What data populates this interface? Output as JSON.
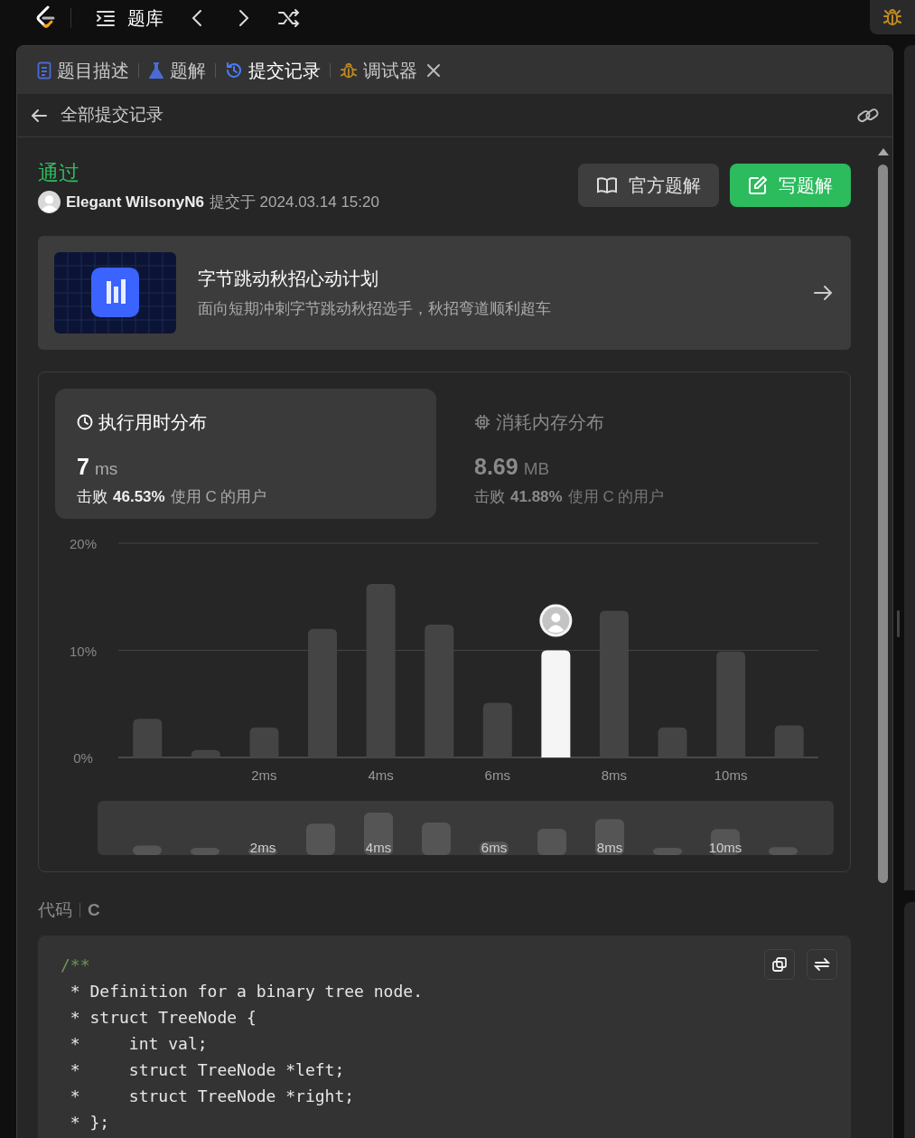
{
  "top_bar": {
    "nav_label": "题库"
  },
  "tabs": [
    {
      "label": "题目描述",
      "kind": "description",
      "selected": false,
      "closable": false
    },
    {
      "label": "题解",
      "kind": "solutions",
      "selected": false,
      "closable": false
    },
    {
      "label": "提交记录",
      "kind": "submissions",
      "selected": true,
      "closable": false
    },
    {
      "label": "调试器",
      "kind": "debugger",
      "selected": false,
      "closable": true
    }
  ],
  "subheader": {
    "title": "全部提交记录"
  },
  "submission": {
    "status": "通过",
    "user": "Elegant WilsonyN6",
    "submitted_at": "提交于 2024.03.14 15:20"
  },
  "buttons": [
    {
      "label": "官方题解",
      "kind": "secondary"
    },
    {
      "label": "写题解",
      "kind": "primary"
    }
  ],
  "banner": {
    "title": "字节跳动秋招心动计划",
    "subtitle": "面向短期冲刺字节跳动秋招选手，秋招弯道顺利超车"
  },
  "stats": [
    {
      "kind": "time",
      "title": "执行用时分布",
      "value": "7",
      "unit": "ms",
      "beat_label": "击败",
      "beat": "46.53%",
      "suffix": "使用 C 的用户",
      "selected": true
    },
    {
      "kind": "memory",
      "title": "消耗内存分布",
      "value": "8.69",
      "unit": "MB",
      "beat_label": "击败",
      "beat": "41.88%",
      "suffix": "使用 C 的用户",
      "selected": false
    }
  ],
  "chart": {
    "chart_data": {
      "type": "bar",
      "x": [
        0,
        1,
        2,
        3,
        4,
        5,
        6,
        7,
        8,
        9,
        10,
        11
      ],
      "series": [
        {
          "color": "#444444",
          "values": [
            3.6,
            0.7,
            2.8,
            12.0,
            16.2,
            12.4,
            5.1,
            null,
            13.7,
            2.8,
            9.9,
            3.0
          ]
        },
        {
          "color": "#f5f5f5",
          "values": [
            null,
            null,
            null,
            null,
            null,
            null,
            null,
            10.0,
            null,
            null,
            null,
            null
          ]
        }
      ],
      "xlim": [
        -0.5,
        11.5
      ],
      "ylim": [
        0,
        20
      ],
      "yticks": [
        {
          "value": 0,
          "label": "0%"
        },
        {
          "value": 10,
          "label": "10%"
        },
        {
          "value": 20,
          "label": "20%"
        }
      ],
      "xticks": [
        {
          "value": 2,
          "label": "2ms"
        },
        {
          "value": 4,
          "label": "4ms"
        },
        {
          "value": 6,
          "label": "6ms"
        },
        {
          "value": 8,
          "label": "8ms"
        },
        {
          "value": 10,
          "label": "10ms"
        }
      ]
    },
    "bars": [
      {
        "selected": false
      },
      {
        "selected": false
      },
      {
        "selected": false
      },
      {
        "selected": false
      },
      {
        "selected": false
      },
      {
        "selected": false
      },
      {
        "selected": false
      },
      {
        "selected": true
      },
      {
        "selected": false
      },
      {
        "selected": false
      },
      {
        "selected": false
      },
      {
        "selected": false
      }
    ],
    "brush_labels": [
      "2ms",
      "4ms",
      "6ms",
      "8ms",
      "10ms"
    ]
  },
  "code": {
    "label": "代码",
    "language": "C",
    "lines": [
      {
        "kind": "marker",
        "text": "/**"
      },
      {
        "kind": "doc",
        "text": " * Definition for a binary tree node."
      },
      {
        "kind": "doc",
        "text": " * struct TreeNode {"
      },
      {
        "kind": "doc",
        "text": " *     int val;"
      },
      {
        "kind": "doc",
        "text": " *     struct TreeNode *left;"
      },
      {
        "kind": "doc",
        "text": " *     struct TreeNode *right;"
      },
      {
        "kind": "doc",
        "text": " * };"
      }
    ]
  }
}
